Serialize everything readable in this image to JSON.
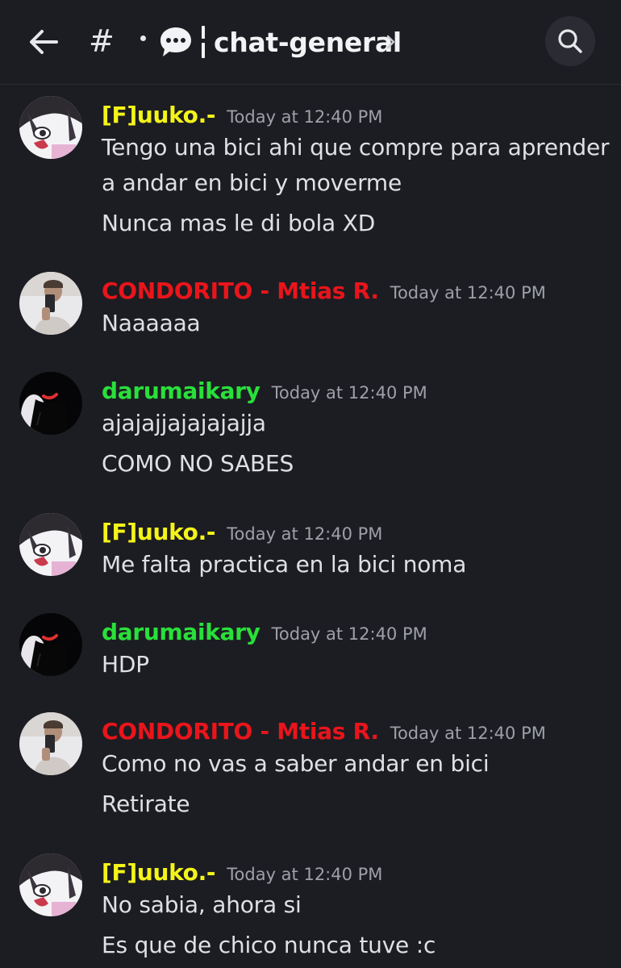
{
  "header": {
    "back_icon": "arrow-left-icon",
    "channel_prefix": "#",
    "channel_emoji": "speech-bubble-icon",
    "channel_name": "chat-general",
    "search_icon": "search-icon"
  },
  "colors": {
    "background": "#1c1d22",
    "fluuko": "#f4f41a",
    "condorito": "#e8151b",
    "darumaikary": "#29e03a",
    "timestamp": "#9ea0a8",
    "message_text": "#dfe0e4"
  },
  "messages": [
    {
      "author": "[F]uuko.-",
      "timestamp": "Today at 12:40 PM",
      "lines": [
        "Tengo una bici ahi que compre para aprender",
        "a andar en bici y moverme",
        "Nunca mas le di bola XD"
      ]
    },
    {
      "author": "CONDORITO - Mtias R.",
      "timestamp": "Today at 12:40 PM",
      "lines": [
        "Naaaaaa"
      ]
    },
    {
      "author": "darumaikary",
      "timestamp": "Today at 12:40 PM",
      "lines": [
        "ajajajjajajajajja",
        "COMO NO SABES"
      ]
    },
    {
      "author": "[F]uuko.-",
      "timestamp": "Today at 12:40 PM",
      "lines": [
        "Me falta practica en la bici noma"
      ]
    },
    {
      "author": "darumaikary",
      "timestamp": "Today at 12:40 PM",
      "lines": [
        "HDP"
      ]
    },
    {
      "author": "CONDORITO - Mtias R.",
      "timestamp": "Today at 12:40 PM",
      "lines": [
        "Como no vas a saber andar en bici",
        "Retirate"
      ]
    },
    {
      "author": "[F]uuko.-",
      "timestamp": "Today at 12:40 PM",
      "lines": [
        "No sabia, ahora si",
        "Es que de  chico nunca tuve :c"
      ]
    }
  ]
}
